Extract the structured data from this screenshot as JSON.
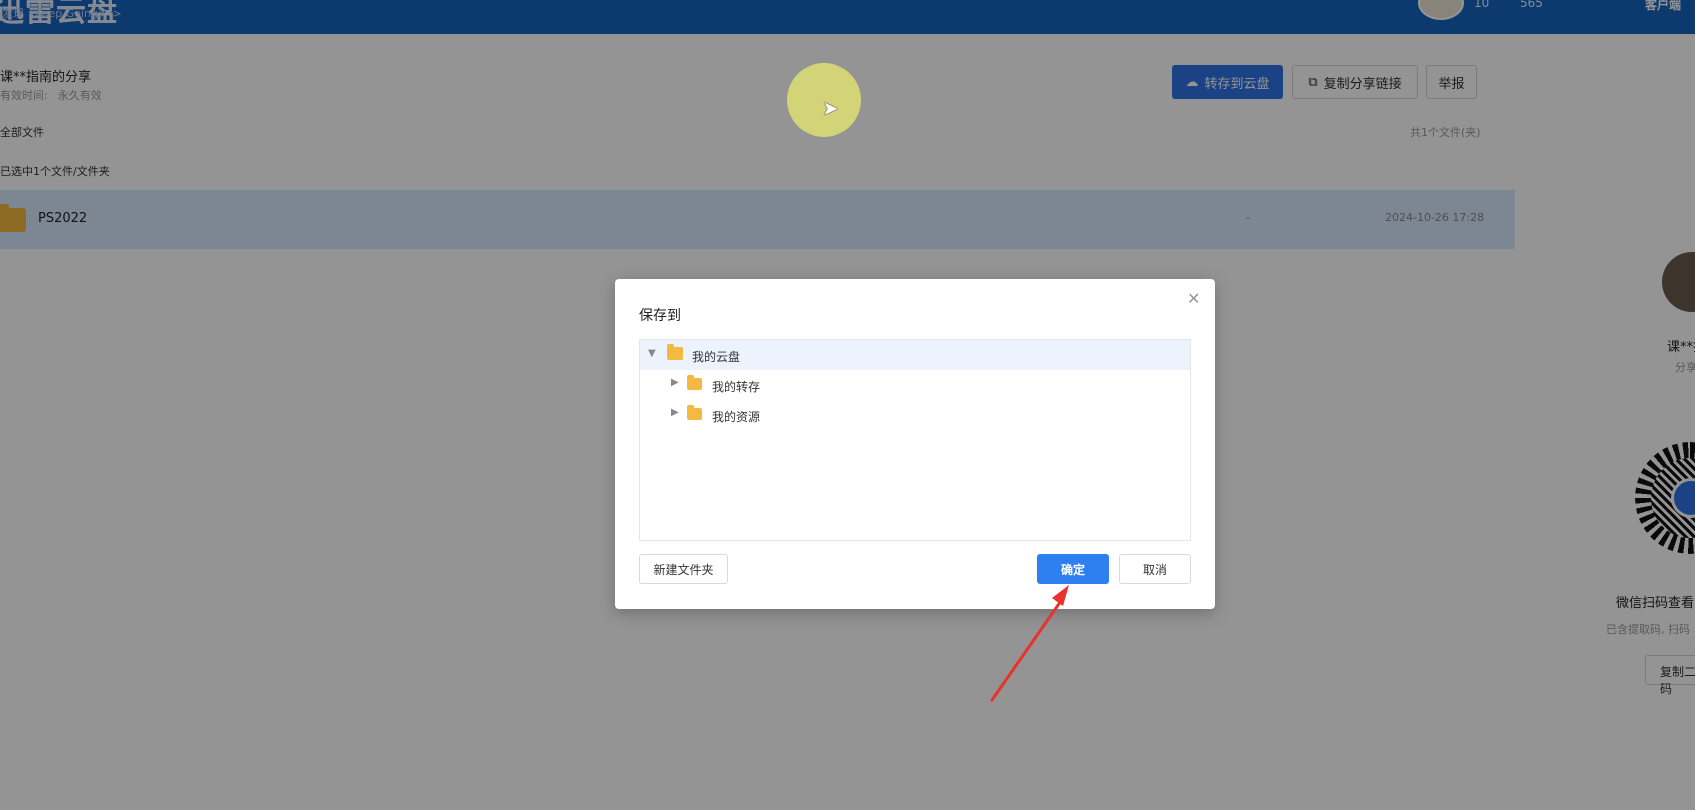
{
  "header": {
    "logo": "迅雷云盘",
    "breadcrumb": "发现《Keep Going》 >",
    "count1": "10",
    "count2": "565",
    "user": "客户端"
  },
  "share": {
    "title": "课**指南的分享",
    "validity_label": "有效时间:",
    "validity_value": "永久有效",
    "actions": {
      "save": "转存到云盘",
      "copy_link": "复制分享链接",
      "report": "举报"
    },
    "all_files": "全部文件",
    "file_count": "共1个文件(夹)",
    "selected": "已选中1个文件/文件夹",
    "files": [
      {
        "name": "PS2022",
        "size": "-",
        "date": "2024-10-26 17:28"
      }
    ]
  },
  "sidebar": {
    "name": "课**指南",
    "sub": "分享",
    "qr_caption": "微信扫码查看",
    "qr_sub": "已含提取码, 扫码",
    "qr_button": "复制二维码"
  },
  "dialog": {
    "title": "保存到",
    "close_icon": "close-icon",
    "tree": {
      "root": "我的云盘",
      "children": [
        "我的转存",
        "我的资源"
      ]
    },
    "new_folder": "新建文件夹",
    "ok": "确定",
    "cancel": "取消"
  },
  "colors": {
    "primary": "#2e73e6",
    "topbar": "#1565c0",
    "folder": "#f5b841",
    "annotation": "#e8322e"
  }
}
